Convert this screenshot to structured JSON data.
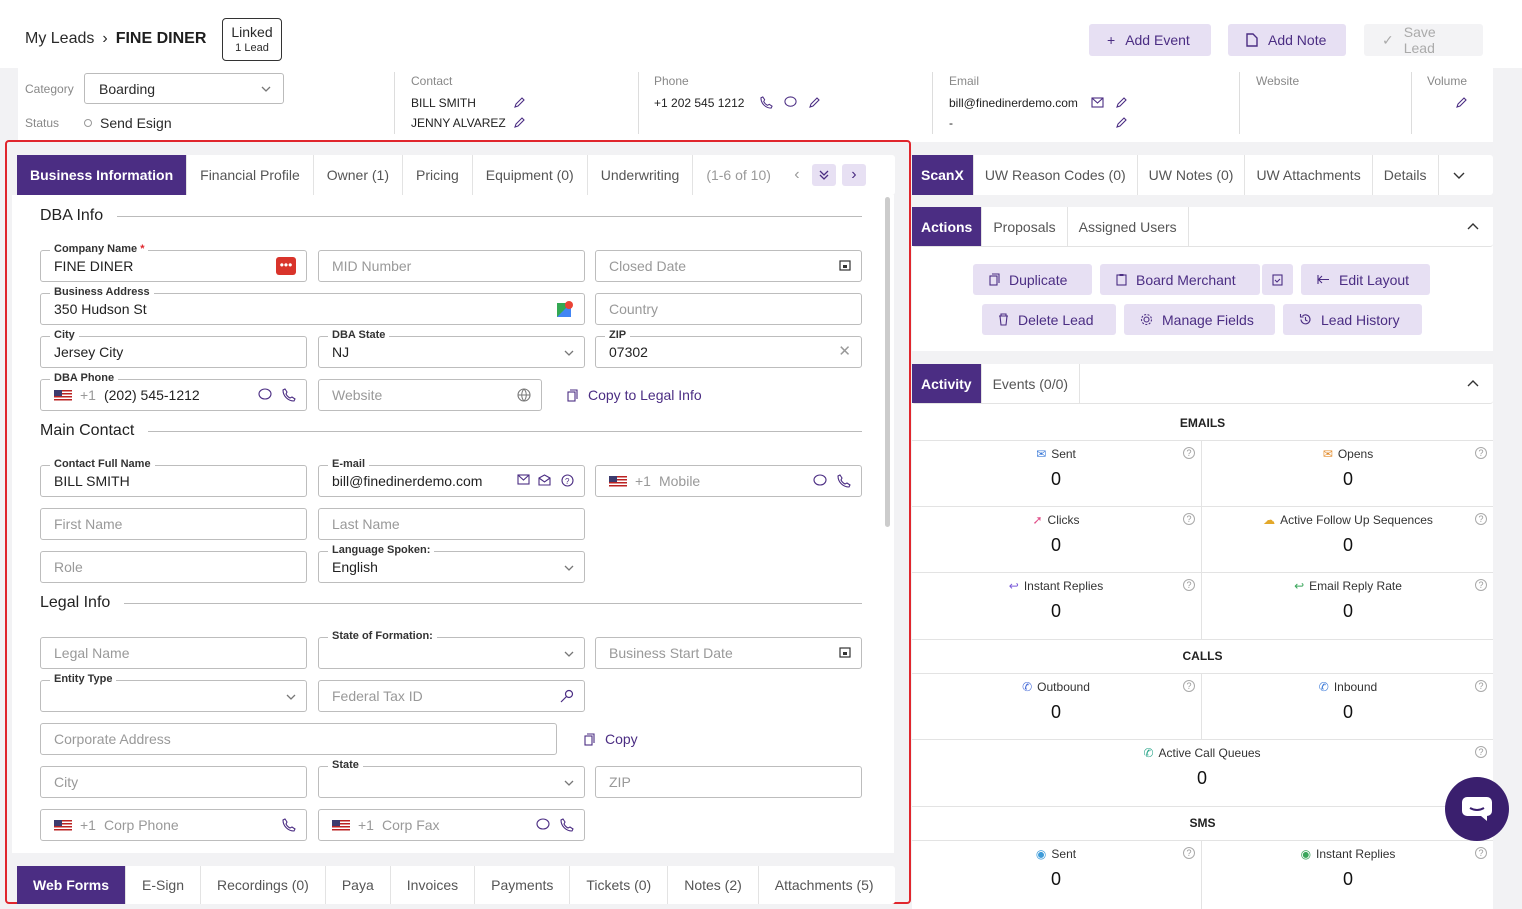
{
  "breadcrumb": {
    "root": "My Leads",
    "current": "FINE DINER"
  },
  "linked": {
    "title": "Linked",
    "sub": "1 Lead"
  },
  "header_buttons": {
    "add_event": "Add Event",
    "add_note": "Add Note",
    "save_lead": "Save Lead"
  },
  "info": {
    "category_label": "Category",
    "category_value": "Boarding",
    "status_label": "Status",
    "status_value": "Send Esign",
    "contact_label": "Contact",
    "contact_1": "BILL SMITH",
    "contact_2": "JENNY ALVAREZ",
    "phone_label": "Phone",
    "phone_value": "+1 202 545 1212",
    "email_label": "Email",
    "email_value": "bill@finedinerdemo.com",
    "email_2": "-",
    "website_label": "Website",
    "volume_label": "Volume"
  },
  "left_tabs": [
    "Business Information",
    "Financial Profile",
    "Owner (1)",
    "Pricing",
    "Equipment (0)",
    "Underwriting"
  ],
  "left_tabs_pager": "(1-6 of 10)",
  "form": {
    "dba_title": "DBA Info",
    "company_name_label": "Company Name",
    "company_name": "FINE DINER",
    "mid_ph": "MID Number",
    "closed_ph": "Closed Date",
    "address_label": "Business Address",
    "address": "350 Hudson St",
    "country_ph": "Country",
    "city_label": "City",
    "city": "Jersey City",
    "state_label": "DBA State",
    "state": "NJ",
    "zip_label": "ZIP",
    "zip": "07302",
    "phone_label": "DBA Phone",
    "phone_cc": "+1",
    "phone": "(202) 545-1212",
    "website_ph": "Website",
    "copy_legal": "Copy to Legal Info",
    "main_title": "Main Contact",
    "fullname_label": "Contact Full Name",
    "fullname": "BILL SMITH",
    "email_label": "E-mail",
    "email": "bill@finedinerdemo.com",
    "mobile_cc": "+1",
    "mobile_ph": "Mobile",
    "first_ph": "First Name",
    "last_ph": "Last Name",
    "role_ph": "Role",
    "lang_label": "Language Spoken:",
    "lang": "English",
    "legal_title": "Legal Info",
    "legal_name_ph": "Legal Name",
    "formation_label": "State of Formation:",
    "start_ph": "Business Start Date",
    "entity_label": "Entity Type",
    "tax_ph": "Federal Tax ID",
    "corp_addr_ph": "Corporate Address",
    "copy": "Copy",
    "city_ph": "City",
    "state2_label": "State",
    "zip_ph": "ZIP",
    "corp_phone_cc": "+1",
    "corp_phone_ph": "Corp Phone",
    "corp_fax_cc": "+1",
    "corp_fax_ph": "Corp Fax"
  },
  "bottom_tabs": [
    "Web Forms",
    "E-Sign",
    "Recordings (0)",
    "Paya",
    "Invoices",
    "Payments",
    "Tickets (0)",
    "Notes (2)",
    "Attachments (5)"
  ],
  "right_tabs": [
    "ScanX",
    "UW Reason Codes (0)",
    "UW Notes (0)",
    "UW Attachments",
    "Details"
  ],
  "action_tabs": [
    "Actions",
    "Proposals",
    "Assigned Users"
  ],
  "actions": {
    "duplicate": "Duplicate",
    "board": "Board Merchant",
    "edit_layout": "Edit Layout",
    "delete": "Delete Lead",
    "manage": "Manage Fields",
    "history": "Lead History"
  },
  "activity_tabs": [
    "Activity",
    "Events (0/0)"
  ],
  "activity": {
    "emails": "EMAILS",
    "sent": "Sent",
    "sent_v": "0",
    "opens": "Opens",
    "opens_v": "0",
    "clicks": "Clicks",
    "clicks_v": "0",
    "afus": "Active Follow Up Sequences",
    "afus_v": "0",
    "instant": "Instant Replies",
    "instant_v": "0",
    "reply_rate": "Email Reply Rate",
    "reply_rate_v": "0",
    "calls": "CALLS",
    "outbound": "Outbound",
    "outbound_v": "0",
    "inbound": "Inbound",
    "inbound_v": "0",
    "queues": "Active Call Queues",
    "queues_v": "0",
    "sms": "SMS",
    "sms_sent": "Sent",
    "sms_sent_v": "0",
    "sms_instant": "Instant Replies",
    "sms_instant_v": "0"
  },
  "colors": {
    "accent": "#4b2d83",
    "accent_light": "#e7e0f3",
    "highlight": "#e0262d"
  }
}
